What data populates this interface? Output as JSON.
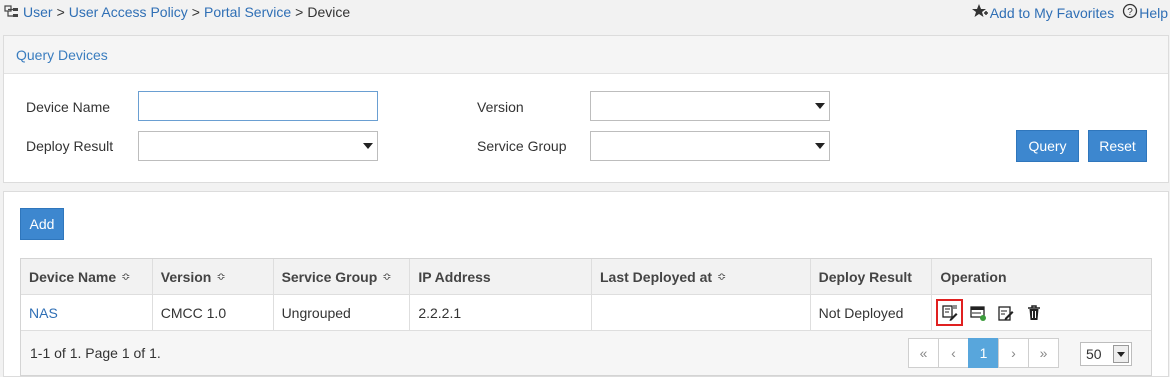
{
  "breadcrumb": {
    "items": [
      "User",
      "User Access Policy",
      "Portal Service"
    ],
    "separator": ">",
    "current": "Device"
  },
  "top_links": {
    "favorites": "Add to My Favorites",
    "help": "Help"
  },
  "query": {
    "title": "Query Devices",
    "device_name_label": "Device Name",
    "device_name_value": "",
    "version_label": "Version",
    "version_value": "",
    "deploy_result_label": "Deploy Result",
    "deploy_result_value": "",
    "service_group_label": "Service Group",
    "service_group_value": "",
    "query_button": "Query",
    "reset_button": "Reset"
  },
  "list": {
    "add_button": "Add",
    "columns": [
      "Device Name",
      "Version",
      "Service Group",
      "IP Address",
      "Last Deployed at",
      "Deploy Result",
      "Operation"
    ],
    "sortable": [
      true,
      true,
      true,
      false,
      true,
      false,
      false
    ],
    "sort_glyph": "≎",
    "rows": [
      {
        "device_name": "NAS",
        "version": "CMCC 1.0",
        "service_group": "Ungrouped",
        "ip_address": "2.2.2.1",
        "last_deployed_at": "",
        "deploy_result": "Not Deployed",
        "operations": [
          "deploy-icon",
          "sync-icon",
          "edit-icon",
          "delete-icon"
        ]
      }
    ],
    "summary": "1-1 of 1. Page 1 of 1.",
    "pager": {
      "first": "«",
      "prev": "‹",
      "current_page": "1",
      "next": "›",
      "last": "»"
    },
    "page_size": "50"
  },
  "colors": {
    "link": "#2f6fb5",
    "button": "#3d87cf",
    "active_page": "#58a6dc",
    "highlight": "#e02020"
  }
}
